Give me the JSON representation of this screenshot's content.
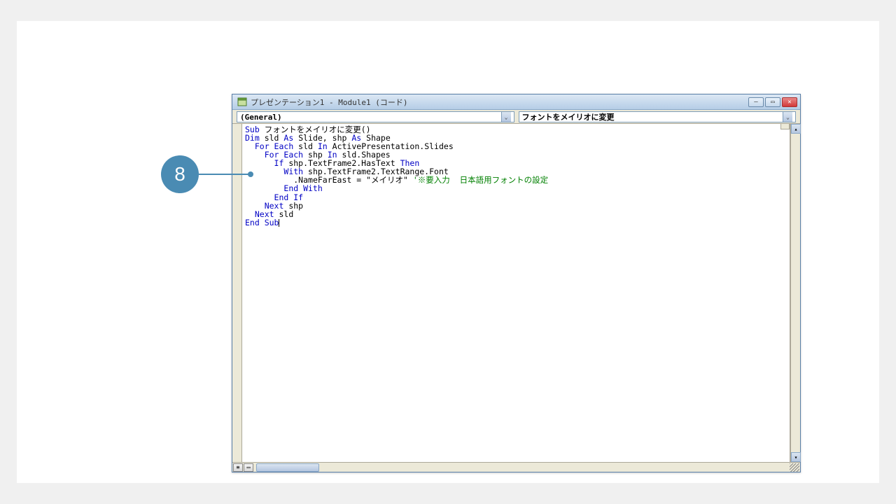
{
  "callout": {
    "number": "8"
  },
  "window": {
    "title": "プレゼンテーション1 - Module1 (コード)"
  },
  "dropdowns": {
    "left": "(General)",
    "right": "フォントをメイリオに変更"
  },
  "code": {
    "lines": [
      {
        "indent": 0,
        "segs": [
          {
            "t": "Sub ",
            "c": "kw"
          },
          {
            "t": "フォントをメイリオに変更()"
          }
        ]
      },
      {
        "indent": 0,
        "segs": [
          {
            "t": "Dim ",
            "c": "kw"
          },
          {
            "t": "sld "
          },
          {
            "t": "As ",
            "c": "kw"
          },
          {
            "t": "Slide, shp "
          },
          {
            "t": "As ",
            "c": "kw"
          },
          {
            "t": "Shape"
          }
        ]
      },
      {
        "indent": 1,
        "segs": [
          {
            "t": "For Each ",
            "c": "kw"
          },
          {
            "t": "sld "
          },
          {
            "t": "In ",
            "c": "kw"
          },
          {
            "t": "ActivePresentation.Slides"
          }
        ]
      },
      {
        "indent": 2,
        "segs": [
          {
            "t": "For Each ",
            "c": "kw"
          },
          {
            "t": "shp "
          },
          {
            "t": "In ",
            "c": "kw"
          },
          {
            "t": "sld.Shapes"
          }
        ]
      },
      {
        "indent": 3,
        "segs": [
          {
            "t": "If ",
            "c": "kw"
          },
          {
            "t": "shp.TextFrame2.HasText "
          },
          {
            "t": "Then",
            "c": "kw"
          }
        ]
      },
      {
        "indent": 4,
        "segs": [
          {
            "t": "With ",
            "c": "kw"
          },
          {
            "t": "shp.TextFrame2.TextRange.Font"
          }
        ]
      },
      {
        "indent": 5,
        "segs": [
          {
            "t": ".NameFarEast = \"メイリオ\" "
          },
          {
            "t": "'※要入力  日本語用フォントの設定",
            "c": "cm"
          }
        ]
      },
      {
        "indent": 4,
        "segs": [
          {
            "t": "End With",
            "c": "kw"
          }
        ]
      },
      {
        "indent": 3,
        "segs": [
          {
            "t": "End If",
            "c": "kw"
          }
        ]
      },
      {
        "indent": 2,
        "segs": [
          {
            "t": "Next ",
            "c": "kw"
          },
          {
            "t": "shp"
          }
        ]
      },
      {
        "indent": 1,
        "segs": [
          {
            "t": "Next ",
            "c": "kw"
          },
          {
            "t": "sld"
          }
        ]
      },
      {
        "indent": 0,
        "segs": [
          {
            "t": "End Sub",
            "c": "kw"
          }
        ],
        "cursor": true
      }
    ],
    "indentUnit": "  "
  },
  "controls": {
    "minimize": "—",
    "maximize": "▭",
    "close": "✕",
    "dropdownArrow": "⌄",
    "scrollUp": "▴",
    "scrollDown": "▾",
    "viewProcedure": "≡",
    "viewFull": "▭"
  }
}
